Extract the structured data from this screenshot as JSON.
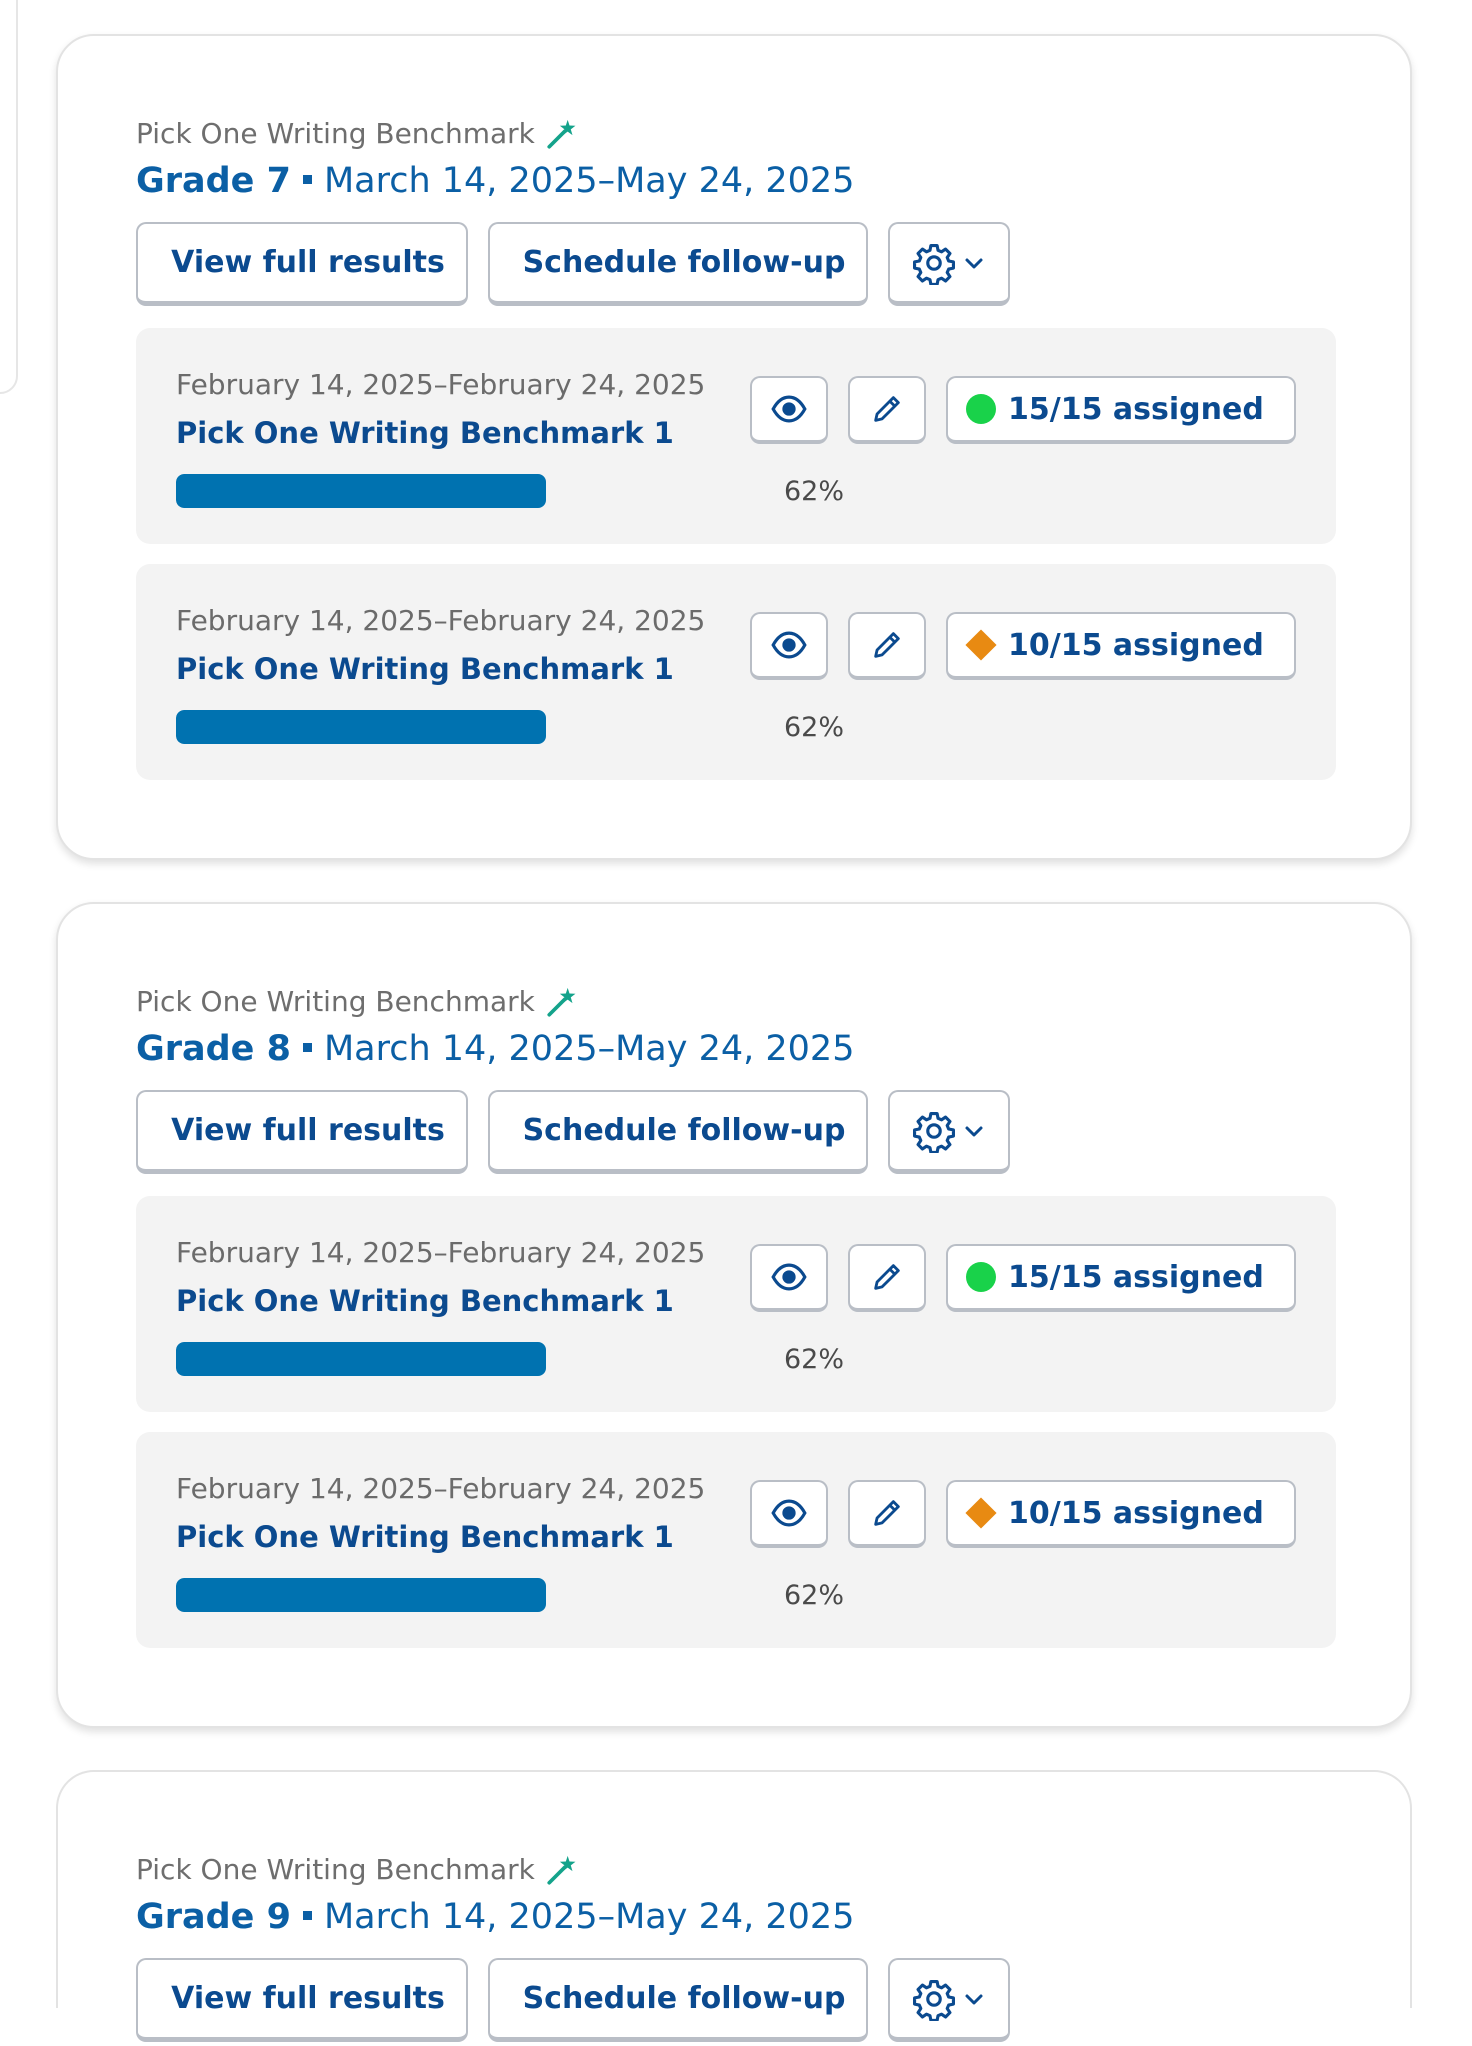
{
  "cards": [
    {
      "eyebrow": "Pick One Writing Benchmark",
      "grade": "Grade 7",
      "date_range": "March 14, 2025–May 24, 2025",
      "buttons": {
        "results": "View full results",
        "schedule": "Schedule follow-up"
      },
      "rows": [
        {
          "date": "February 14, 2025–February 24, 2025",
          "title": "Pick One Writing Benchmark 1",
          "progress": 62,
          "progress_label": "62%",
          "assigned": "15/15 assigned",
          "status": "complete"
        },
        {
          "date": "February 14, 2025–February 24, 2025",
          "title": "Pick One Writing Benchmark 1",
          "progress": 62,
          "progress_label": "62%",
          "assigned": "10/15 assigned",
          "status": "partial"
        }
      ]
    },
    {
      "eyebrow": "Pick One Writing Benchmark",
      "grade": "Grade 8",
      "date_range": "March 14, 2025–May 24, 2025",
      "buttons": {
        "results": "View full results",
        "schedule": "Schedule follow-up"
      },
      "rows": [
        {
          "date": "February 14, 2025–February 24, 2025",
          "title": "Pick One Writing Benchmark 1",
          "progress": 62,
          "progress_label": "62%",
          "assigned": "15/15 assigned",
          "status": "complete"
        },
        {
          "date": "February 14, 2025–February 24, 2025",
          "title": "Pick One Writing Benchmark 1",
          "progress": 62,
          "progress_label": "62%",
          "assigned": "10/15 assigned",
          "status": "partial"
        }
      ]
    },
    {
      "eyebrow": "Pick One Writing Benchmark",
      "grade": "Grade 9",
      "date_range": "March 14, 2025–May 24, 2025",
      "buttons": {
        "results": "View full results",
        "schedule": "Schedule follow-up"
      },
      "rows": []
    }
  ],
  "colors": {
    "primary": "#0b4a8f",
    "progress": "#0072b0",
    "status_complete": "#19d24a",
    "status_partial": "#e88a12",
    "accent_icon": "#14a38b"
  },
  "icons": {
    "eyebrow": "magic-wand-icon",
    "results": "bar-chart-icon",
    "schedule": "calendar-icon",
    "settings": "gear-icon",
    "view": "eye-icon",
    "edit": "pencil-icon",
    "message": "mail-icon"
  }
}
